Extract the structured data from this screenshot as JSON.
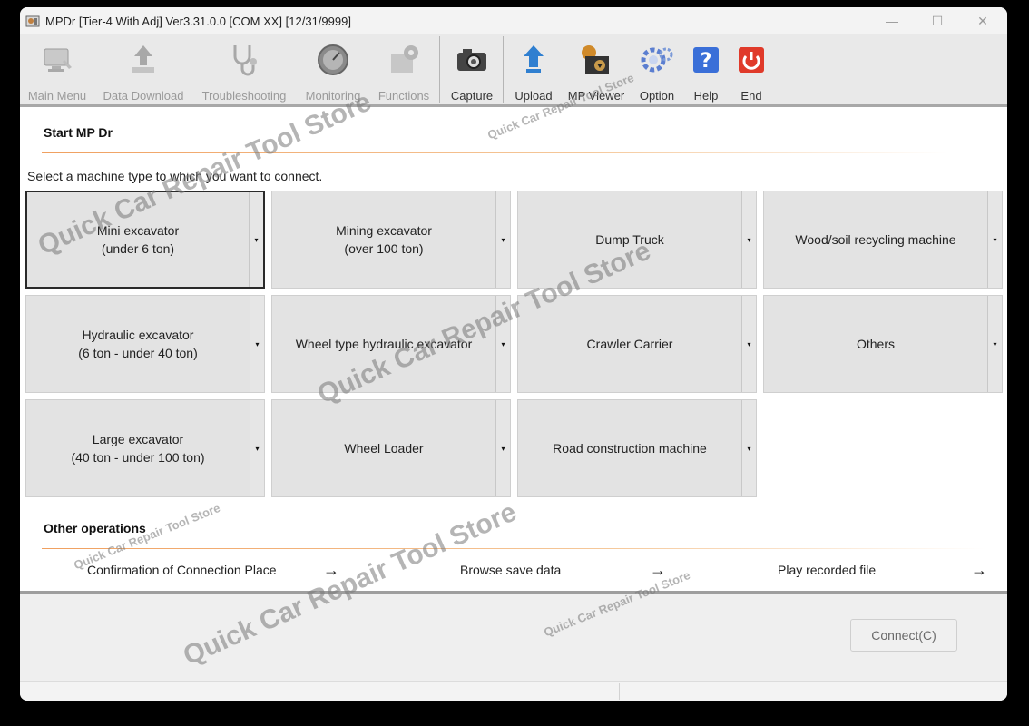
{
  "window": {
    "title": "MPDr [Tier-4 With Adj] Ver3.31.0.0 [COM XX] [12/31/9999]",
    "controls": {
      "minimize": "—",
      "maximize": "☐",
      "close": "✕"
    }
  },
  "toolbar": {
    "main_menu": "Main Menu",
    "data_download": "Data Download",
    "troubleshooting": "Troubleshooting",
    "monitoring": "Monitoring",
    "functions": "Functions",
    "capture": "Capture",
    "upload": "Upload",
    "mp_viewer": "MP Viewer",
    "option": "Option",
    "help": "Help",
    "end": "End"
  },
  "start": {
    "title": "Start MP Dr",
    "prompt": "Select a machine type to which you want to connect."
  },
  "machines": {
    "mini_excavator": "Mini excavator\n(under 6 ton)",
    "mining_excavator": "Mining excavator\n(over 100 ton)",
    "dump_truck": "Dump Truck",
    "wood_soil": "Wood/soil recycling machine",
    "hydraulic_excavator": "Hydraulic excavator\n(6 ton - under 40 ton)",
    "wheel_hydraulic": "Wheel type hydraulic excavator",
    "crawler_carrier": "Crawler Carrier",
    "others": "Others",
    "large_excavator": "Large excavator\n(40 ton - under 100 ton)",
    "wheel_loader": "Wheel Loader",
    "road_construction": "Road construction machine",
    "dropdown_glyph": "▾"
  },
  "other_operations": {
    "title": "Other operations",
    "confirmation": "Confirmation of Connection Place",
    "browse": "Browse save data",
    "play": "Play recorded file",
    "arrow": "→"
  },
  "footer": {
    "connect": "Connect(C)"
  },
  "watermark": {
    "large": "Quick Car Repair Tool Store",
    "small": "Quick Car Repair Tool Store"
  },
  "colors": {
    "accent_line": "#f0a060",
    "end_button": "#e03a2a",
    "help_button": "#3a6fd8"
  }
}
